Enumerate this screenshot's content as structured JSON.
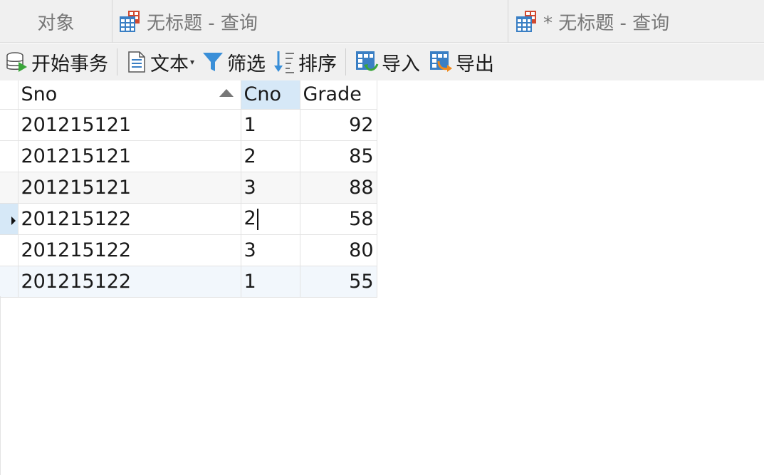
{
  "tabs": [
    {
      "label": "对象"
    },
    {
      "label": "无标题 - 查询"
    },
    {
      "label": "* 无标题 - 查询"
    }
  ],
  "toolbar": {
    "begin_transaction": "开始事务",
    "text": "文本",
    "filter": "筛选",
    "sort": "排序",
    "import": "导入",
    "export": "导出"
  },
  "grid": {
    "columns": [
      "Sno",
      "Cno",
      "Grade"
    ],
    "sorted_column": "Sno",
    "rows": [
      {
        "sno": "201215121",
        "cno": "1",
        "grade": "92"
      },
      {
        "sno": "201215121",
        "cno": "2",
        "grade": "85"
      },
      {
        "sno": "201215121",
        "cno": "3",
        "grade": "88"
      },
      {
        "sno": "201215122",
        "cno": "2",
        "grade": "58"
      },
      {
        "sno": "201215122",
        "cno": "3",
        "grade": "80"
      },
      {
        "sno": "201215122",
        "cno": "1",
        "grade": "55"
      }
    ],
    "current_row_index": 3
  },
  "colors": {
    "toolbar_bg": "#f0f0f0",
    "selection": "#d6e8f7",
    "icon_blue": "#3a7fc4",
    "icon_red": "#d0492f",
    "icon_green": "#3aa53a",
    "icon_orange": "#f08a1c"
  }
}
